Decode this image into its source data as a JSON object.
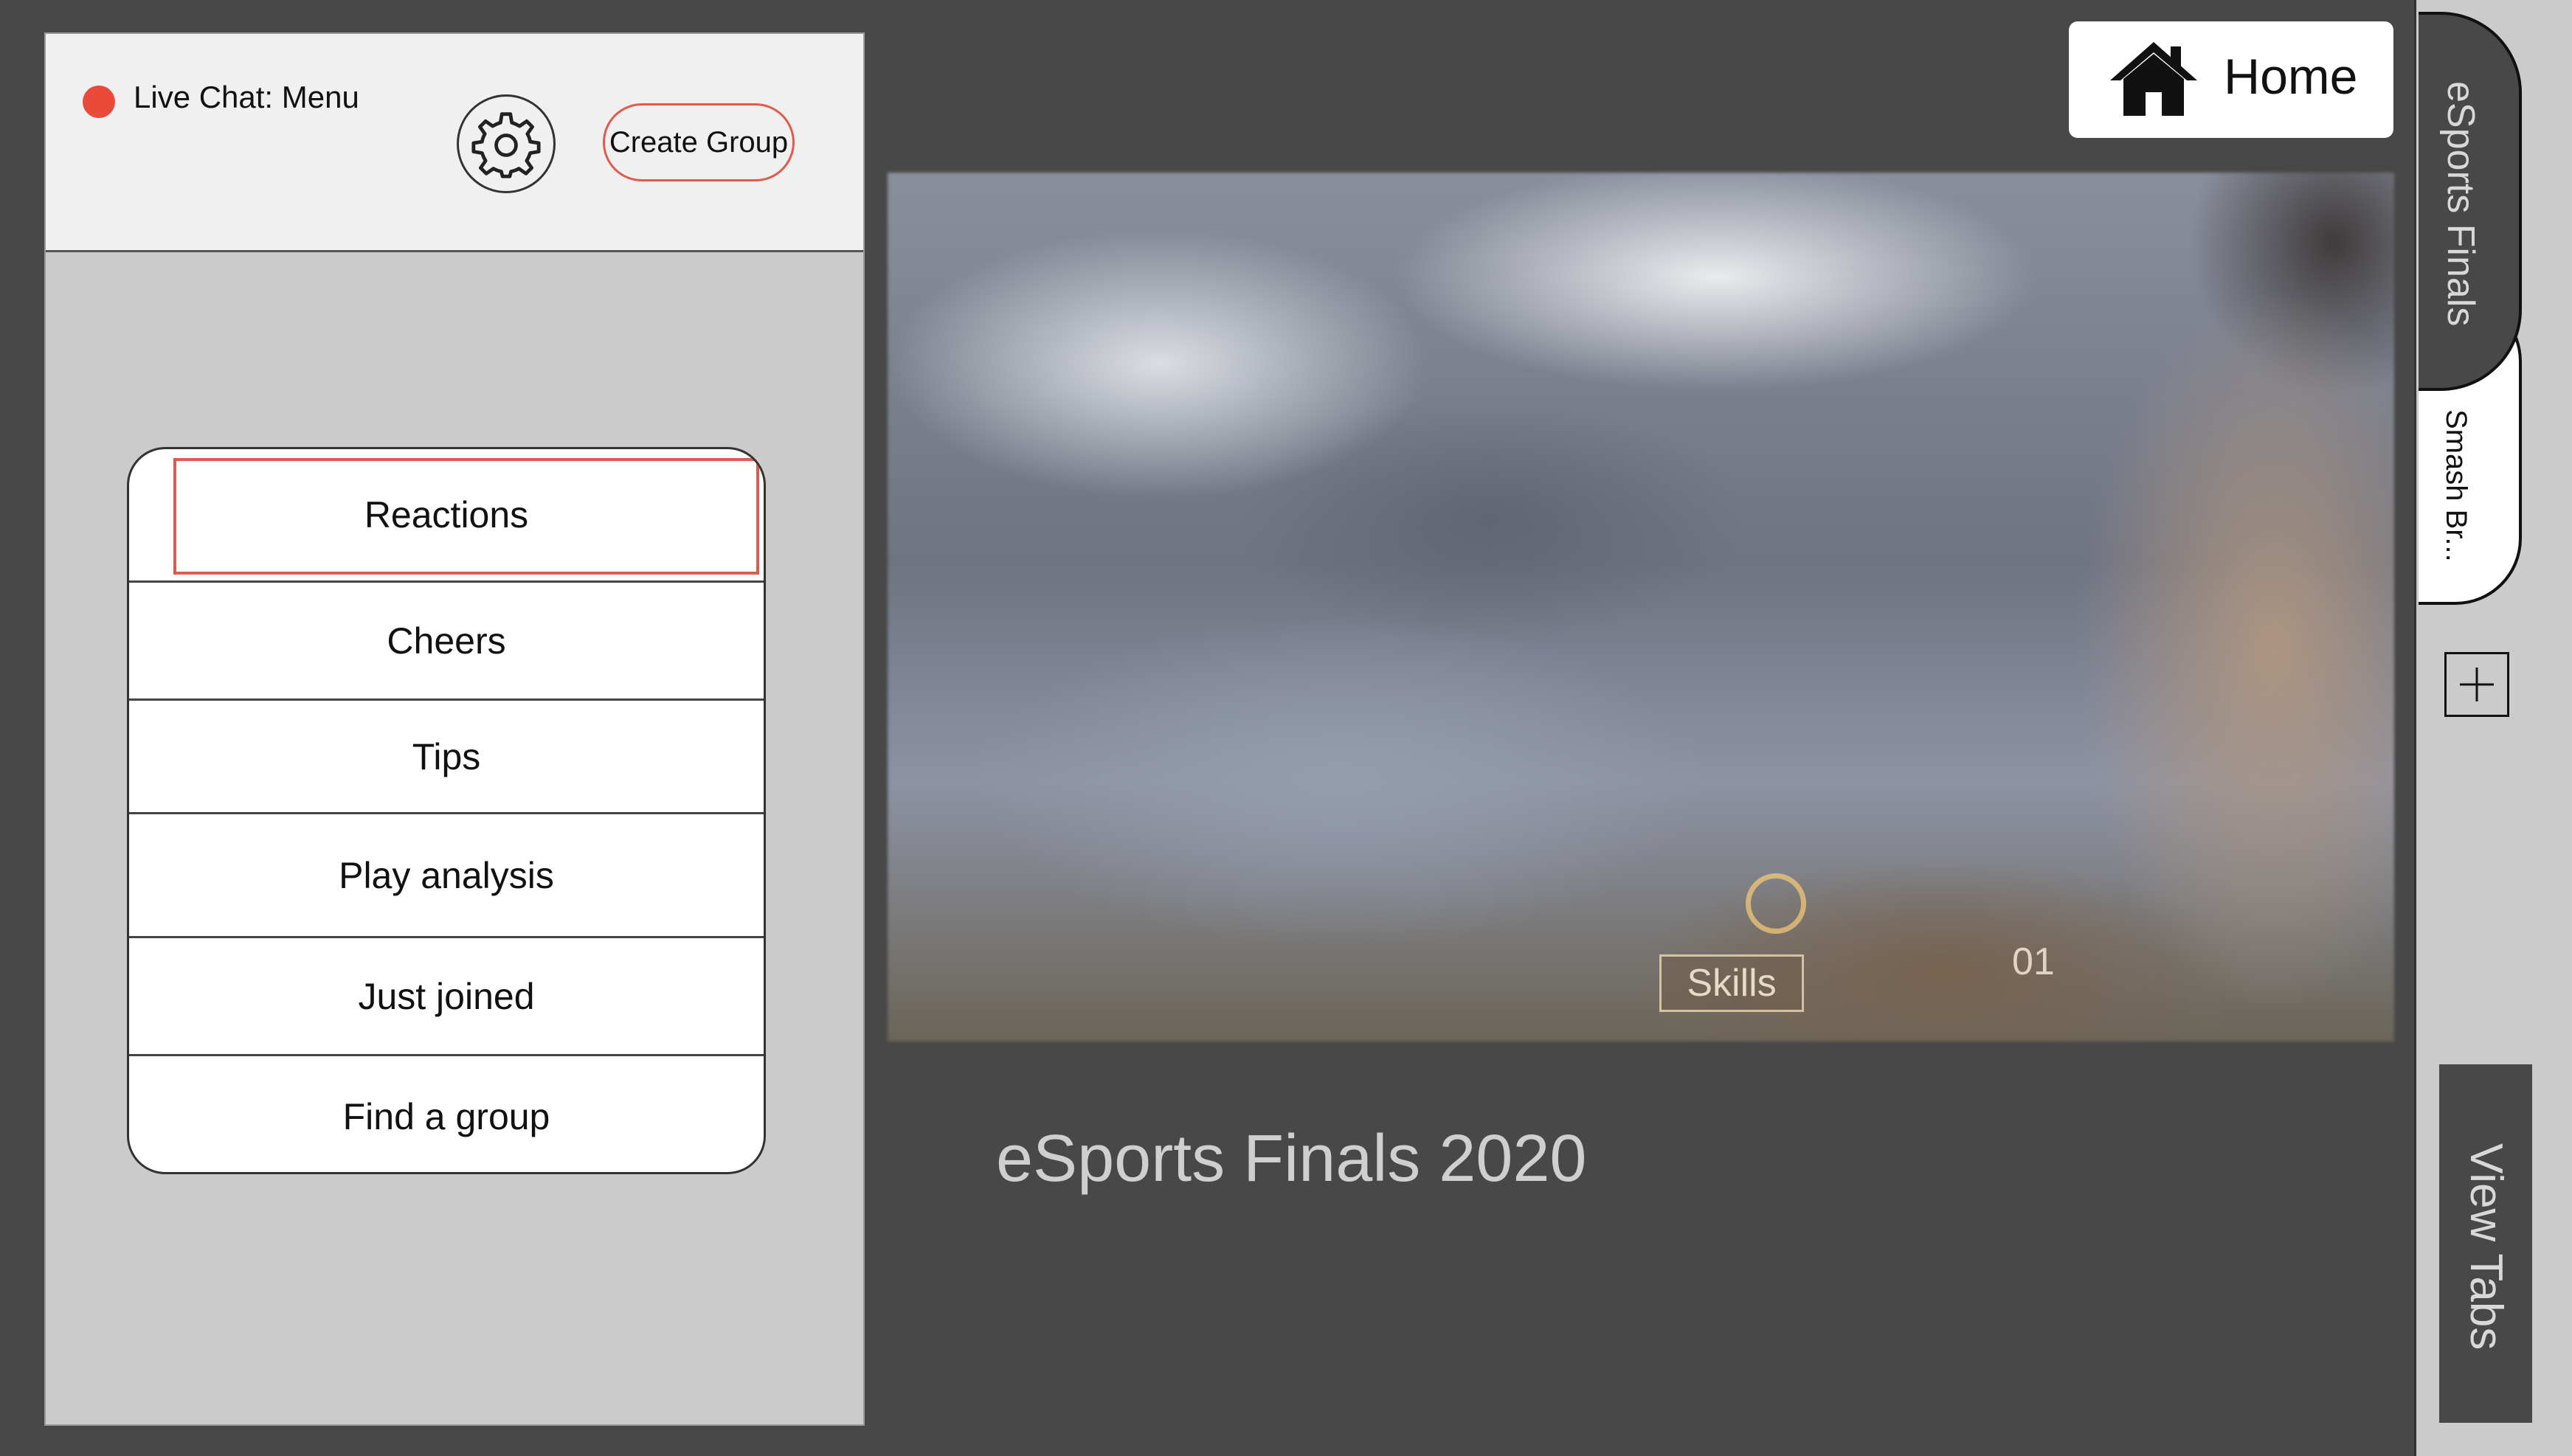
{
  "chat": {
    "title": "Live Chat: Menu",
    "live_color": "#ea4a3a",
    "settings_icon": "gear-icon",
    "create_group_label": "Create Group",
    "menu_items": [
      {
        "label": "Reactions",
        "selected": true
      },
      {
        "label": "Cheers"
      },
      {
        "label": "Tips"
      },
      {
        "label": "Play analysis"
      },
      {
        "label": "Just joined"
      },
      {
        "label": "Find a group"
      }
    ]
  },
  "video": {
    "hud_skills": "Skills",
    "hud_number": "01"
  },
  "event_title": "eSports Finals 2020",
  "home": {
    "label": "Home",
    "icon": "home-icon"
  },
  "tabs": {
    "items": [
      {
        "label": "eSports Finals",
        "active": true
      },
      {
        "label": "Smash Br..."
      }
    ],
    "add_icon": "plus-icon",
    "view_tabs_label": "View Tabs"
  },
  "colors": {
    "accent": "#e05a4e",
    "background": "#484848",
    "panel": "#cbcbcb"
  }
}
